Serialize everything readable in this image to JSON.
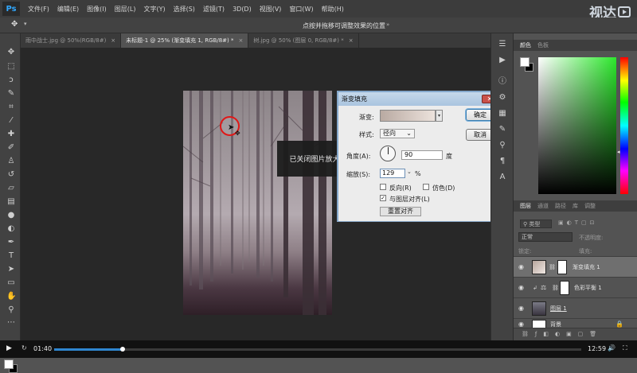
{
  "menu": {
    "logo": "Ps",
    "items": [
      "文件(F)",
      "编辑(E)",
      "图像(I)",
      "图层(L)",
      "文字(Y)",
      "选择(S)",
      "滤镜(T)",
      "3D(D)",
      "视图(V)",
      "窗口(W)",
      "帮助(H)"
    ]
  },
  "brand": {
    "text": "视达"
  },
  "options": {
    "hint": "点按并拖移可调整效果的位置",
    "hint_arrow": "»"
  },
  "tabs": [
    {
      "label": "雨中战士.jpg @ 50%(RGB/8#)",
      "close": "×",
      "active": false
    },
    {
      "label": "未标题-1 @ 25% (渐变填充 1, RGB/8#) *",
      "close": "×",
      "active": true
    },
    {
      "label": "树.jpg @ 50% (图层 0, RGB/8#) *",
      "close": "×",
      "active": false
    }
  ],
  "toast": {
    "text": "已关闭图片放大镜"
  },
  "dialog": {
    "title": "渐变填充",
    "close": "✕",
    "gradient_label": "渐变:",
    "style_label": "样式:",
    "style_value": "径向",
    "angle_label": "角度(A):",
    "angle_value": "90",
    "angle_unit": "度",
    "scale_label": "缩放(S):",
    "scale_value": "129",
    "scale_unit": "%",
    "reverse_label": "反向(R)",
    "reverse_checked": false,
    "dither_label": "仿色(D)",
    "dither_checked": false,
    "align_label": "与图层对齐(L)",
    "align_checked": true,
    "reset_label": "重置对齐",
    "ok_label": "确定",
    "cancel_label": "取消"
  },
  "color_panel": {
    "tabs": [
      "颜色",
      "色板"
    ],
    "fg_color": "#ffffff",
    "bg_color": "#000000",
    "field_hue": "#2ce82c"
  },
  "layers_panel": {
    "tabs": [
      "图层",
      "通道",
      "路径",
      "库",
      "调整"
    ],
    "kind_filter": "类型",
    "blend_mode": "正常",
    "opacity_label": "不透明度:",
    "lock_label": "锁定:",
    "fill_label": "填充:",
    "layers": [
      {
        "name": "渐变填充 1",
        "selected": true
      },
      {
        "name": "色彩平衡 1",
        "selected": false
      },
      {
        "name": "图层 1",
        "selected": false
      },
      {
        "name": "背景",
        "selected": false
      }
    ]
  },
  "player": {
    "current_time": "01:40",
    "total_time": "12:59",
    "progress": 0.13
  }
}
